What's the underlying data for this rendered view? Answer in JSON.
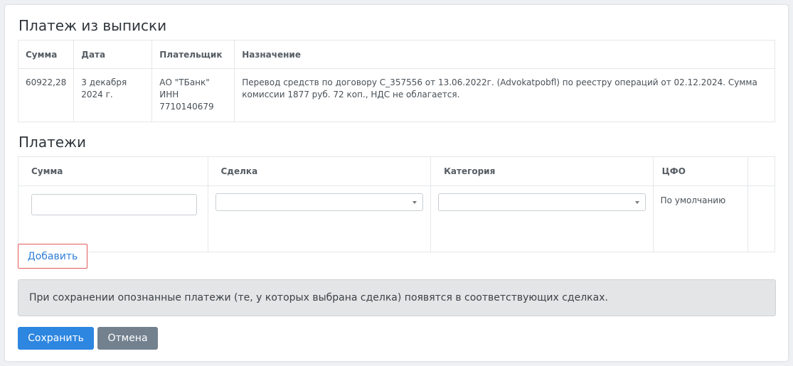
{
  "statement": {
    "title": "Платеж из выписки",
    "columns": [
      "Сумма",
      "Дата",
      "Плательщик",
      "Назначение"
    ],
    "row": {
      "amount": "60922,28",
      "date_line1": "3 декабря",
      "date_line2": "2024 г.",
      "payer_line1": "АО \"ТБанк\"",
      "payer_line2": "ИНН",
      "payer_line3": "7710140679",
      "purpose": "Перевод средств по договору C_357556 от 13.06.2022г. (Advokatpobfl) по реестру операций от 02.12.2024. Сумма комиссии 1877 руб. 72 коп., НДС не облагается."
    }
  },
  "payments": {
    "title": "Платежи",
    "columns": [
      "Сумма",
      "Сделка",
      "Категория",
      "ЦФО"
    ],
    "row": {
      "amount_value": "",
      "deal_value": "",
      "category_value": "",
      "cfo": "По умолчанию"
    }
  },
  "actions": {
    "add_label": "Добавить",
    "notice": "При сохранении опознанные платежи (те, у которых выбрана сделка) появятся в соответствующих сделках.",
    "save_label": "Сохранить",
    "cancel_label": "Отмена"
  },
  "colors": {
    "primary": "#2d86e0",
    "secondary": "#73818f",
    "add_border": "#e25a5a",
    "notice_bg": "#e4e5e6"
  },
  "icons": [
    "chevron-down-icon"
  ]
}
